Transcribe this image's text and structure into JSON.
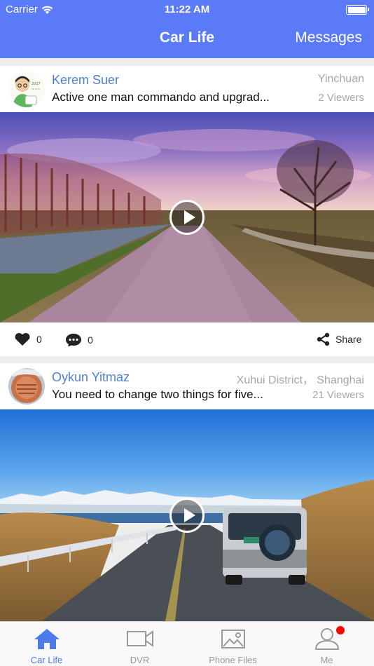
{
  "status_bar": {
    "carrier": "Carrier",
    "time": "11:22 AM"
  },
  "nav": {
    "title": "Car Life",
    "messages_label": "Messages"
  },
  "posts": [
    {
      "user_name": "Kerem Suer",
      "location": "Yinchuan",
      "text": "Active one man commando and upgrad...",
      "viewers": "2 Viewers",
      "likes": "0",
      "comments": "0",
      "share_label": "Share"
    },
    {
      "user_name": "Oykun Yitmaz",
      "location": "Xuhui District，  Shanghai",
      "text": "You need to change two things for five...",
      "viewers": "21 Viewers"
    }
  ],
  "tabs": [
    {
      "label": "Car Life",
      "icon": "home-icon",
      "active": true
    },
    {
      "label": "DVR",
      "icon": "video-camera-icon",
      "active": false
    },
    {
      "label": "Phone Files",
      "icon": "image-icon",
      "active": false
    },
    {
      "label": "Me",
      "icon": "user-icon",
      "active": false,
      "badge": true
    }
  ],
  "colors": {
    "accent": "#5b7af8",
    "active_tab": "#4d7be8",
    "username": "#4d7fd9",
    "badge": "#ff0000"
  }
}
